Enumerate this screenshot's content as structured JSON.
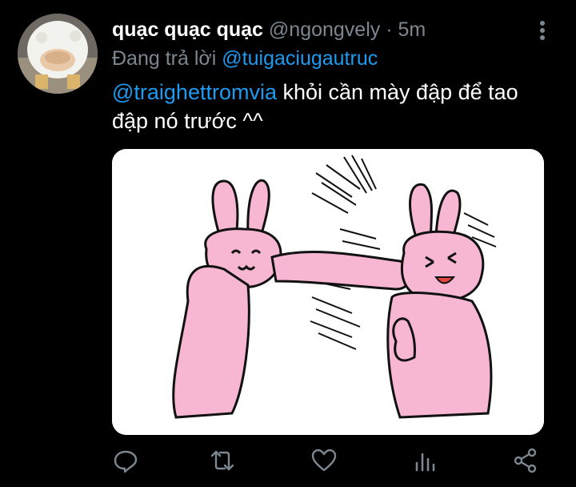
{
  "tweet": {
    "display_name": "quạc quạc quạc",
    "handle": "@ngongvely",
    "separator": "·",
    "time": "5m",
    "replying_prefix": "Đang trả lời",
    "replying_to": "@tuigaciugautruc",
    "mention": "@traighettromvia",
    "body": " khỏi cần mày đập để tao đập nó trước ^^"
  },
  "icons": {
    "avatar": "duck-avatar",
    "more": "more-vertical-icon",
    "reply": "reply-icon",
    "retweet": "retweet-icon",
    "like": "heart-icon",
    "analytics": "analytics-icon",
    "share": "share-icon"
  },
  "colors": {
    "background": "#000000",
    "text": "#ffffff",
    "secondary": "#7c8790",
    "link": "#1d9bf0",
    "bunny": "#f7b7d3"
  }
}
